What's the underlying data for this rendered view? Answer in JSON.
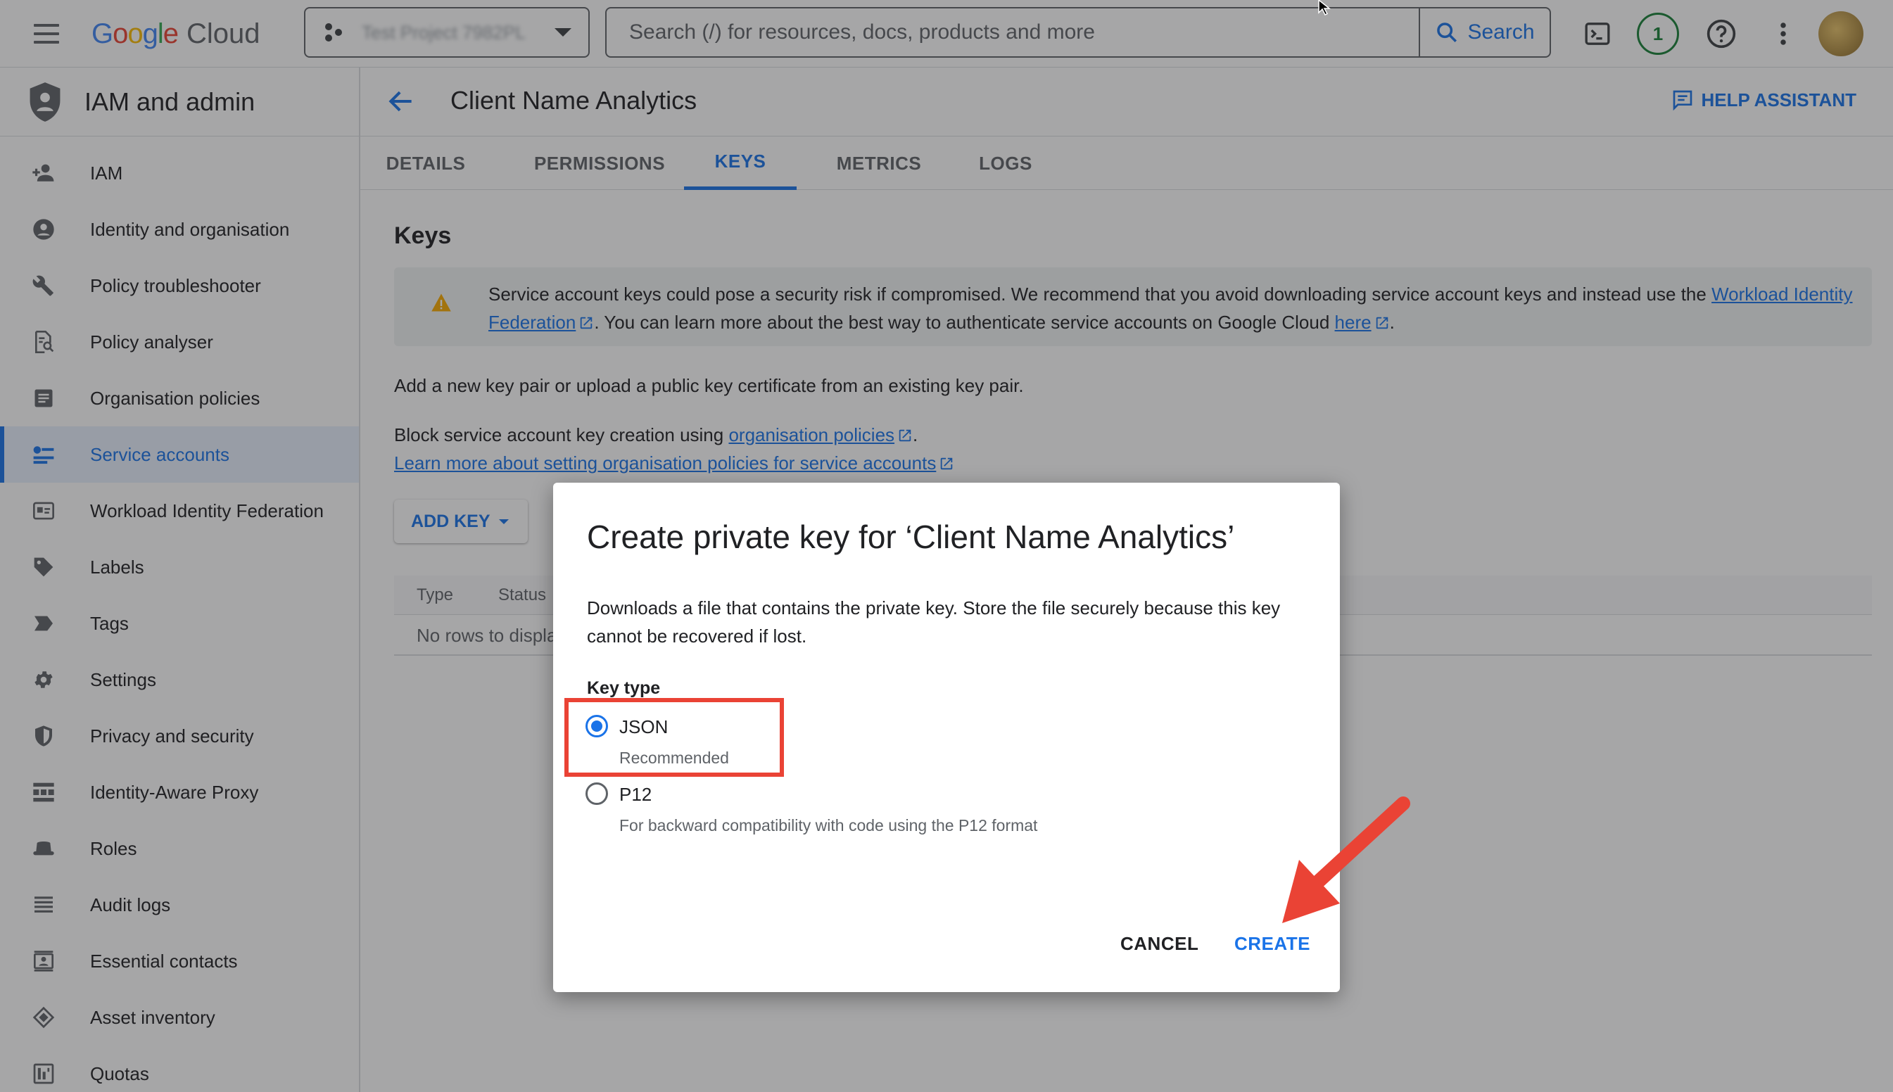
{
  "topbar": {
    "logo_google": "Google",
    "logo_cloud": "Cloud",
    "project_name": "Test Project 7982PL",
    "search_placeholder": "Search (/) for resources, docs, products and more",
    "search_button": "Search",
    "notification_count": "1"
  },
  "sidebar": {
    "title": "IAM and admin",
    "items": [
      {
        "label": "IAM",
        "icon": "person-add-icon"
      },
      {
        "label": "Identity and organisation",
        "icon": "account-circle-icon"
      },
      {
        "label": "Policy troubleshooter",
        "icon": "wrench-icon"
      },
      {
        "label": "Policy analyser",
        "icon": "document-search-icon"
      },
      {
        "label": "Organisation policies",
        "icon": "list-document-icon"
      },
      {
        "label": "Service accounts",
        "icon": "service-account-icon",
        "active": true
      },
      {
        "label": "Workload Identity Federation",
        "icon": "id-card-icon"
      },
      {
        "label": "Labels",
        "icon": "label-icon"
      },
      {
        "label": "Tags",
        "icon": "tag-icon"
      },
      {
        "label": "Settings",
        "icon": "gear-icon"
      },
      {
        "label": "Privacy and security",
        "icon": "shield-icon"
      },
      {
        "label": "Identity-Aware Proxy",
        "icon": "proxy-icon"
      },
      {
        "label": "Roles",
        "icon": "hat-icon"
      },
      {
        "label": "Audit logs",
        "icon": "lines-icon"
      },
      {
        "label": "Essential contacts",
        "icon": "contact-icon"
      },
      {
        "label": "Asset inventory",
        "icon": "layers-icon"
      },
      {
        "label": "Quotas",
        "icon": "quota-icon"
      }
    ]
  },
  "page": {
    "title": "Client Name Analytics",
    "help_assistant": "HELP ASSISTANT",
    "tabs": [
      "DETAILS",
      "PERMISSIONS",
      "KEYS",
      "METRICS",
      "LOGS"
    ],
    "active_tab": "KEYS",
    "section_title": "Keys",
    "warning": {
      "text1": "Service account keys could pose a security risk if compromised. We recommend that you avoid downloading service account keys and instead use the ",
      "link1": "Workload Identity Federation",
      "text2": ". You can learn more about the best way to authenticate service accounts on Google Cloud ",
      "link2": "here",
      "text3": "."
    },
    "add_pair_text": "Add a new key pair or upload a public key certificate from an existing key pair.",
    "block_text": "Block service account key creation using ",
    "block_link": "organisation policies",
    "block_end": ".",
    "learn_more_link": "Learn more about setting organisation policies for service accounts",
    "add_key_button": "ADD KEY",
    "table": {
      "headers": [
        "Type",
        "Status"
      ],
      "empty_text": "No rows to display"
    }
  },
  "dialog": {
    "title": "Create private key for ‘Client Name Analytics’",
    "description": "Downloads a file that contains the private key. Store the file securely because this key cannot be recovered if lost.",
    "key_type_label": "Key type",
    "options": [
      {
        "label": "JSON",
        "sub": "Recommended",
        "checked": true
      },
      {
        "label": "P12",
        "sub": "For backward compatibility with code using the P12 format",
        "checked": false
      }
    ],
    "cancel_button": "CANCEL",
    "create_button": "CREATE"
  },
  "colors": {
    "accent": "#1a73e8",
    "annotation": "#ea4335",
    "notification": "#188038",
    "warning": "#f9ab00"
  }
}
